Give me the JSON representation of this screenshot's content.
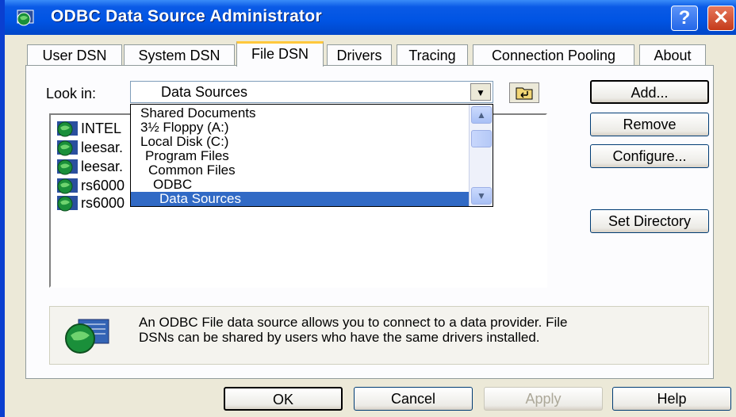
{
  "window": {
    "title": "ODBC Data Source Administrator",
    "help_glyph": "?",
    "close_glyph": "✕"
  },
  "tabs": [
    {
      "label": "User DSN"
    },
    {
      "label": "System DSN"
    },
    {
      "label": "File DSN"
    },
    {
      "label": "Drivers"
    },
    {
      "label": "Tracing"
    },
    {
      "label": "Connection Pooling"
    },
    {
      "label": "About"
    }
  ],
  "active_tab": "File DSN",
  "look_in": {
    "label": "Look in:",
    "value": "Data Sources",
    "options": [
      {
        "label": "Shared Documents",
        "indent": 0
      },
      {
        "label": "3½ Floppy (A:)",
        "indent": 0
      },
      {
        "label": "Local Disk (C:)",
        "indent": 0
      },
      {
        "label": "Program Files",
        "indent": 1
      },
      {
        "label": "Common Files",
        "indent": 2
      },
      {
        "label": "ODBC",
        "indent": 3
      },
      {
        "label": "Data Sources",
        "indent": 4,
        "selected": true
      }
    ]
  },
  "file_list": [
    {
      "name": "INTEL"
    },
    {
      "name": "leesar."
    },
    {
      "name": "leesar."
    },
    {
      "name": "rs6000"
    },
    {
      "name": "rs6000"
    }
  ],
  "side_buttons": {
    "add": "Add...",
    "remove": "Remove",
    "configure": "Configure...",
    "set_directory": "Set Directory"
  },
  "info": {
    "text_line1": "An ODBC File data source allows you to connect to a data provider.  File",
    "text_line2": "DSNs can be shared by users who have the same drivers installed."
  },
  "footer_buttons": {
    "ok": "OK",
    "cancel": "Cancel",
    "apply": "Apply",
    "help": "Help"
  },
  "colors": {
    "titlebar": "#0054e3",
    "selection": "#316ac5",
    "dialog_bg": "#ece9d8"
  }
}
